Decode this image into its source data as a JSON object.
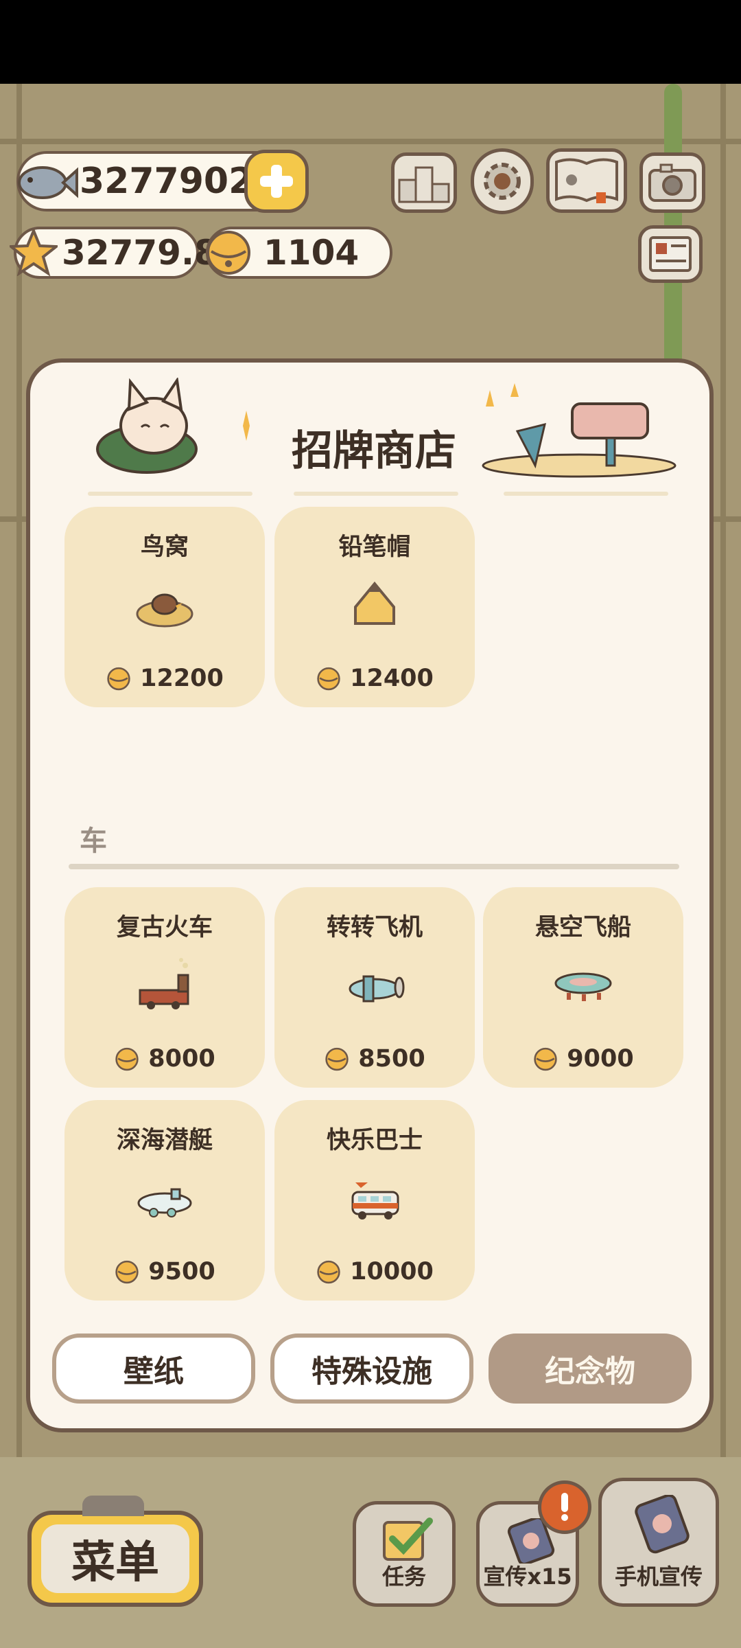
{
  "currency": {
    "fish": "3277902",
    "stars": "32779.8",
    "bells": "1104"
  },
  "panel": {
    "title": "招牌商店"
  },
  "top_items": [
    {
      "name": "鸟窝",
      "price": "12200"
    },
    {
      "name": "铅笔帽",
      "price": "12400"
    }
  ],
  "section": {
    "label": "车"
  },
  "car_items": [
    {
      "name": "复古火车",
      "price": "8000"
    },
    {
      "name": "转转飞机",
      "price": "8500"
    },
    {
      "name": "悬空飞船",
      "price": "9000"
    },
    {
      "name": "深海潜艇",
      "price": "9500"
    },
    {
      "name": "快乐巴士",
      "price": "10000"
    }
  ],
  "tabs": [
    {
      "label": "壁纸",
      "active": false
    },
    {
      "label": "特殊设施",
      "active": false
    },
    {
      "label": "纪念物",
      "active": true
    }
  ],
  "bottom": {
    "menu": "菜单",
    "tasks": "任务",
    "promo": "宣传x15",
    "phone_promo": "手机宣传"
  },
  "colors": {
    "panel_bg": "#fbf5ec",
    "card_bg": "#f5e6c4",
    "border": "#6e5848",
    "active_tab": "#b19a86",
    "accent_yellow": "#f4c84a",
    "alert_orange": "#d9632d"
  }
}
